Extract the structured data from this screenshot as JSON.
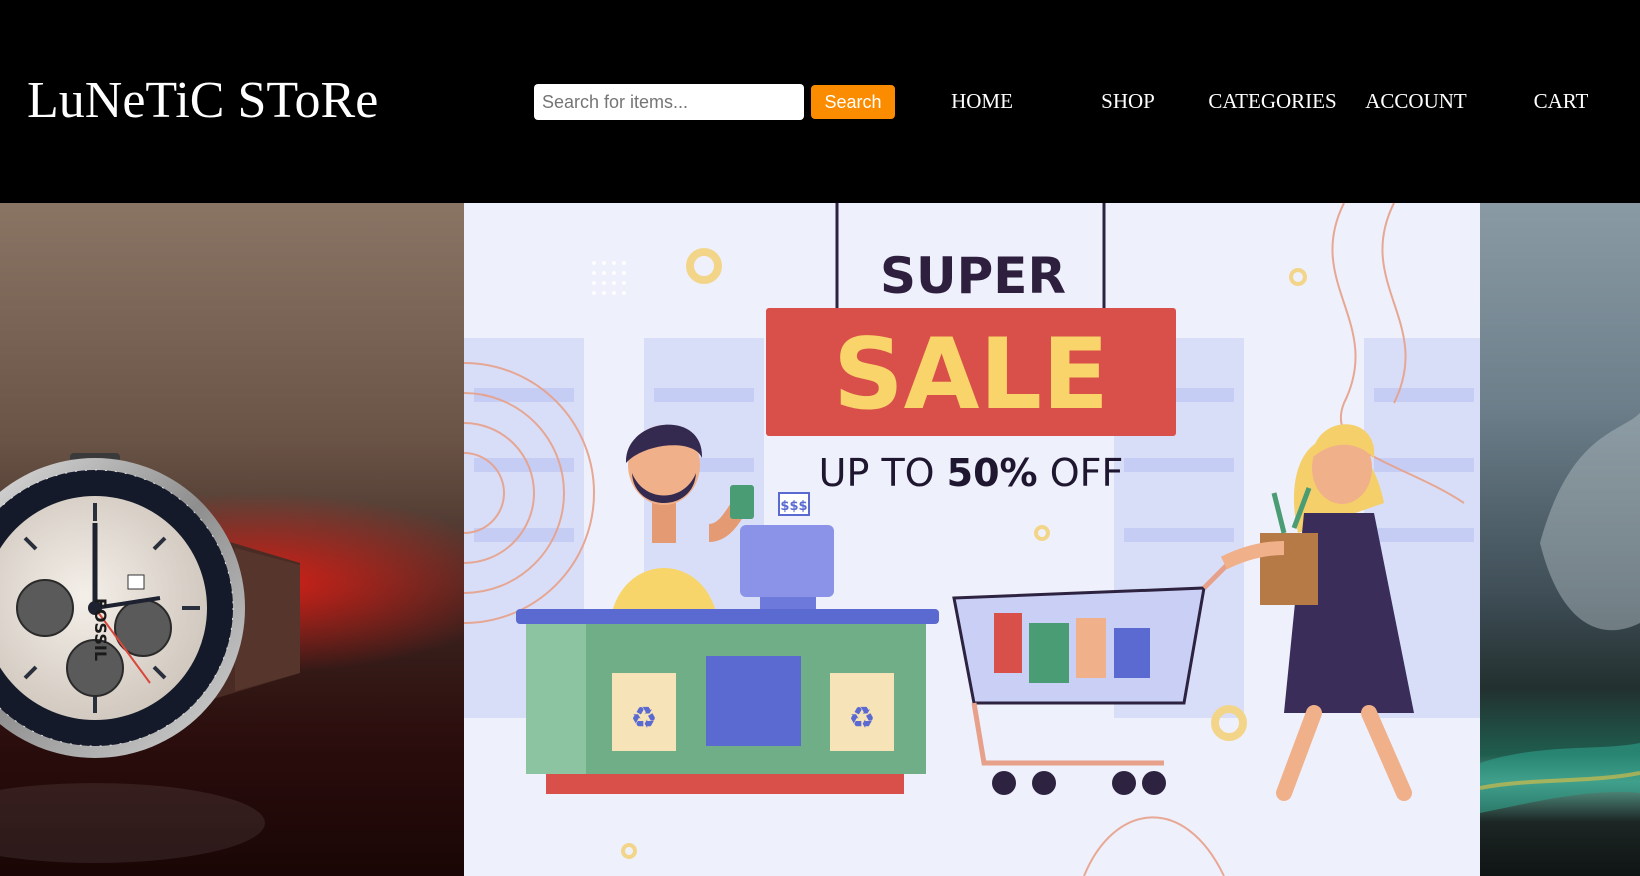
{
  "header": {
    "logo_text": "LuNeTiC SToRe",
    "search": {
      "placeholder": "Search for items...",
      "value": "",
      "button_label": "Search"
    },
    "nav": [
      {
        "label": "HOME"
      },
      {
        "label": "SHOP"
      },
      {
        "label": "CATEGORIES"
      },
      {
        "label": "ACCOUNT"
      },
      {
        "label": "CART"
      }
    ]
  },
  "hero": {
    "left_image": {
      "watch_brand": "FOSSIL"
    },
    "banner": {
      "line1": "SUPER",
      "line2": "SALE",
      "offer_prefix": "UP TO ",
      "offer_value": "50%",
      "offer_suffix": " OFF",
      "register_tag": "$$$"
    }
  },
  "colors": {
    "header_bg": "#000000",
    "search_button": "#fb8c00",
    "nav_text": "#ffffff",
    "banner_bg": "#eef0fb",
    "sale_red": "#d9504a",
    "sale_yellow": "#f8d46a",
    "counter_green": "#6fae86"
  }
}
